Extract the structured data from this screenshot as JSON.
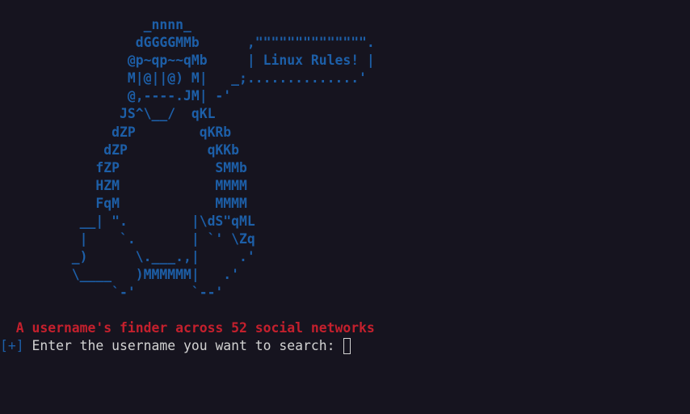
{
  "terminal": {
    "ascii_art": "                  _nnnn_\n                 dGGGGMMb      ,\"\"\"\"\"\"\"\"\"\"\"\"\"\".\n                @p~qp~~qMb     | Linux Rules! |\n                M|@||@) M|   _;..............'\n                @,----.JM| -'\n               JS^\\__/  qKL\n              dZP        qKRb\n             dZP          qKKb\n            fZP            SMMb\n            HZM            MMMM\n            FqM            MMMM\n          __| \".        |\\dS\"qML\n          |    `.       | `' \\Zq\n         _)      \\.___.,|     .'\n         \\____   )MMMMMM|   .'\n              `-'       `--'",
    "tagline": "  A username's finder across 52 social networks",
    "prompt_marker": "[+]",
    "prompt_text": " Enter the username you want to search: ",
    "colors": {
      "background": "#16141f",
      "ascii": "#1d5fa8",
      "tagline": "#c4202d",
      "prompt_text": "#d2d2d2"
    }
  }
}
